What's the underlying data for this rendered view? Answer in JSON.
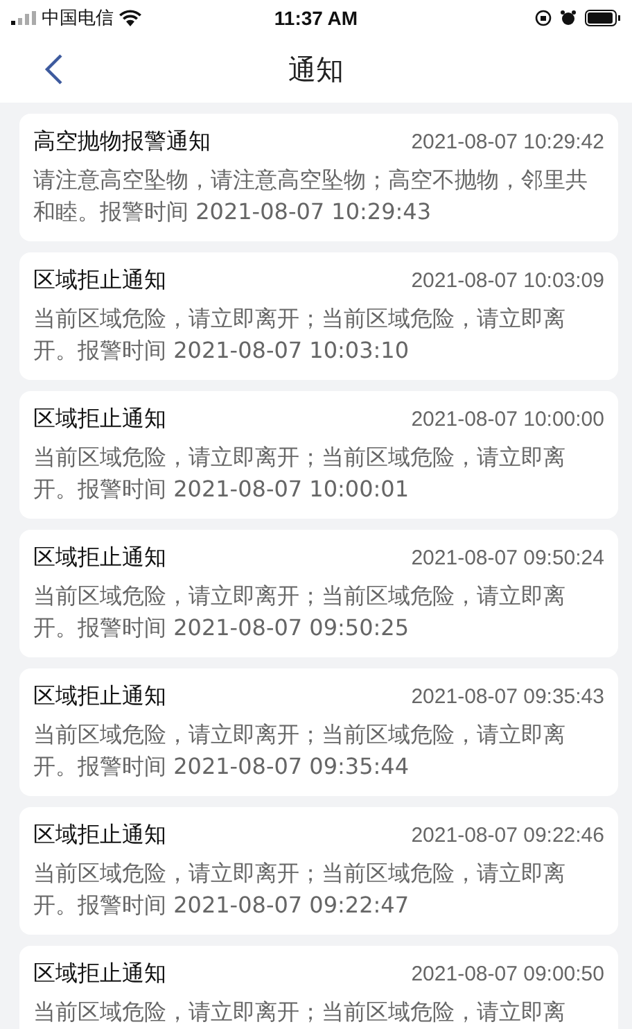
{
  "status_bar": {
    "carrier": "中国电信",
    "time": "11:37 AM"
  },
  "nav": {
    "title": "通知"
  },
  "notifications": [
    {
      "title": "高空抛物报警通知",
      "time": "2021-08-07 10:29:42",
      "message": "请注意高空坠物，请注意高空坠物；高空不抛物，邻里共和睦。报警时间 2021-08-07 10:29:43"
    },
    {
      "title": "区域拒止通知",
      "time": "2021-08-07 10:03:09",
      "message": "当前区域危险，请立即离开；当前区域危险，请立即离开。报警时间 2021-08-07 10:03:10"
    },
    {
      "title": "区域拒止通知",
      "time": "2021-08-07 10:00:00",
      "message": "当前区域危险，请立即离开；当前区域危险，请立即离开。报警时间 2021-08-07 10:00:01"
    },
    {
      "title": "区域拒止通知",
      "time": "2021-08-07 09:50:24",
      "message": "当前区域危险，请立即离开；当前区域危险，请立即离开。报警时间 2021-08-07 09:50:25"
    },
    {
      "title": "区域拒止通知",
      "time": "2021-08-07 09:35:43",
      "message": "当前区域危险，请立即离开；当前区域危险，请立即离开。报警时间 2021-08-07 09:35:44"
    },
    {
      "title": "区域拒止通知",
      "time": "2021-08-07 09:22:46",
      "message": "当前区域危险，请立即离开；当前区域危险，请立即离开。报警时间 2021-08-07 09:22:47"
    },
    {
      "title": "区域拒止通知",
      "time": "2021-08-07 09:00:50",
      "message": "当前区域危险，请立即离开；当前区域危险，请立即离"
    }
  ]
}
